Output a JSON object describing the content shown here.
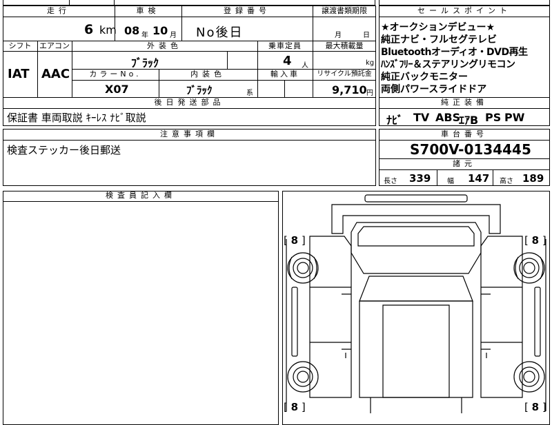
{
  "mileage": {
    "header": "走行",
    "value": "6",
    "unit": "km"
  },
  "inspection": {
    "header": "車検",
    "year": "08",
    "year_unit": "年",
    "month": "10",
    "month_unit": "月"
  },
  "registration": {
    "header": "登録番号",
    "value": "No後日"
  },
  "transfer": {
    "header": "譲渡書類期限",
    "month_unit": "月",
    "day_unit": "日"
  },
  "shift": {
    "header": "シフト",
    "value": "IAT"
  },
  "aircon": {
    "header": "エアコン",
    "value": "AAC"
  },
  "exterior": {
    "header": "外装色",
    "value": "ﾌﾞﾗｯｸ"
  },
  "capacity": {
    "header": "乗車定員",
    "value": "4",
    "unit": "人"
  },
  "max_load": {
    "header": "最大積載量",
    "unit": "kg"
  },
  "color_no": {
    "header": "カラーNo.",
    "value": "X07"
  },
  "interior": {
    "header": "内装色",
    "value": "ﾌﾞﾗｯｸ",
    "suffix": "系"
  },
  "import": {
    "header": "輸入車"
  },
  "recycle": {
    "header": "リサイクル預託金",
    "value": "9,710",
    "unit": "円"
  },
  "sales_points": {
    "header": "セールスポイント",
    "lines": [
      "★オークションデビュー★",
      "純正ナビ・フルセグテレビ",
      "Bluetoothオーディオ・DVD再生",
      "ﾊﾝｽﾞﾌﾘｰ＆ステアリングリモコン",
      "純正バックモニター",
      "両側パワースライドドア"
    ]
  },
  "later_parts": {
    "header": "後日発送部品",
    "value": "保証書 車両取説 ｷｰﾚｽ ﾅﾋﾞ取説"
  },
  "genuine_equipment": {
    "header": "純正装備",
    "items": [
      "ﾅﾋﾞ",
      "TV",
      "ABS",
      "ｴｱB",
      "PS",
      "PW"
    ]
  },
  "notes": {
    "header": "注意事項欄",
    "value": "検査ステッカー後日郵送"
  },
  "chassis": {
    "header": "車台番号",
    "value": "S700V-0134445"
  },
  "specs": {
    "header": "諸元",
    "length_label": "長さ",
    "length": "339",
    "width_label": "幅",
    "width": "147",
    "height_label": "高さ",
    "height": "189"
  },
  "inspector": {
    "header": "検査員記入欄"
  },
  "tires": {
    "front_left": "8",
    "front_right": "8",
    "rear_left": "8",
    "rear_right": "8"
  }
}
